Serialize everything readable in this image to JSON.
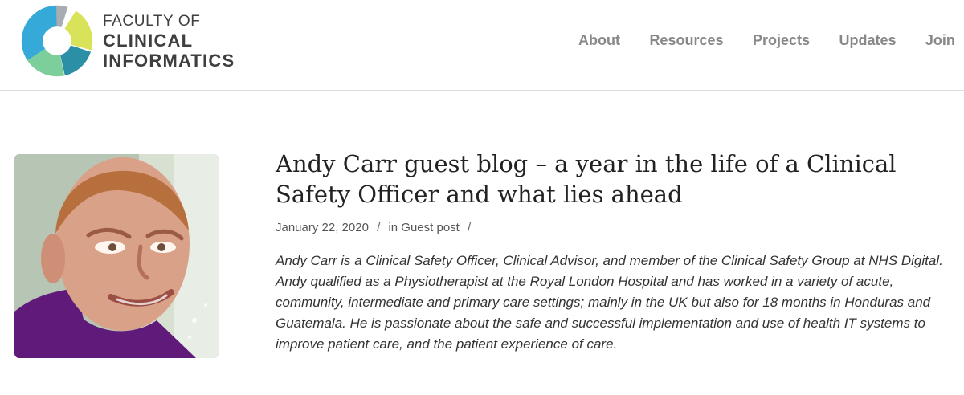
{
  "header": {
    "logo": {
      "line1": "FACULTY OF",
      "line2": "CLINICAL",
      "line3": "INFORMATICS"
    },
    "nav": [
      {
        "label": "About"
      },
      {
        "label": "Resources"
      },
      {
        "label": "Projects"
      },
      {
        "label": "Updates"
      },
      {
        "label": "Join"
      }
    ]
  },
  "post": {
    "title": "Andy Carr guest blog – a year in the life of a Clinical Safety Officer and what lies ahead",
    "date": "January 22, 2020",
    "meta_separator": "/",
    "category_prefix": "in",
    "category": "Guest post",
    "excerpt": {
      "paragraph1": "Andy Carr is a Clinical Safety Officer, Clinical Advisor, and member of the Clinical Safety Group at NHS Digital.",
      "paragraph2": "Andy qualified as a Physiotherapist at the Royal London Hospital and has worked in a variety of acute, community, intermediate and primary care settings; mainly in the UK but also for 18 months in Honduras and Guatemala. He is passionate about the safe and successful implementation and use of health IT systems to improve patient care, and the patient experience of care."
    }
  },
  "colors": {
    "logo_yellow": "#d8e35a",
    "logo_teal": "#2b8fa5",
    "logo_blue": "#35a9d7",
    "logo_green": "#7ccf9a",
    "logo_gray": "#a8adb1",
    "nav_text": "#888888",
    "title_text": "#222222"
  },
  "icons": {
    "logo": "segmented-ring-logo-icon",
    "profile": "author-portrait-image"
  }
}
